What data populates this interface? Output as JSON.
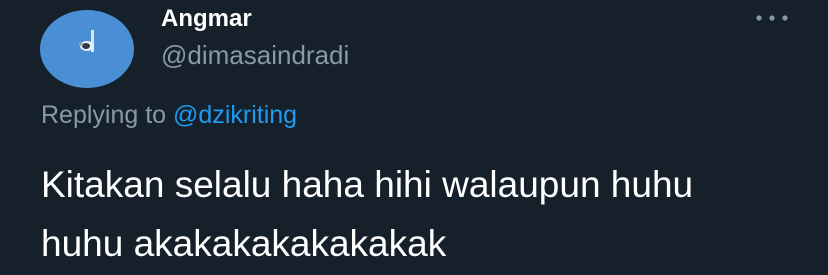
{
  "author": {
    "display_name": "Angmar",
    "handle": "@dimasaindradi",
    "avatar_icon": "profile-avatar"
  },
  "reply": {
    "prefix": "Replying to",
    "mention": "@dzikriting"
  },
  "tweet": {
    "lines": [
      "Kitakan selalu haha hihi walaupun huhu",
      "huhu akakakakakakakak"
    ]
  },
  "more_icon": "more-horizontal-icon",
  "colors": {
    "background": "#15202b",
    "text_primary": "#ffffff",
    "text_secondary": "#8899a6",
    "accent": "#1d9bf0",
    "avatar_bg": "#4a8fd6"
  }
}
